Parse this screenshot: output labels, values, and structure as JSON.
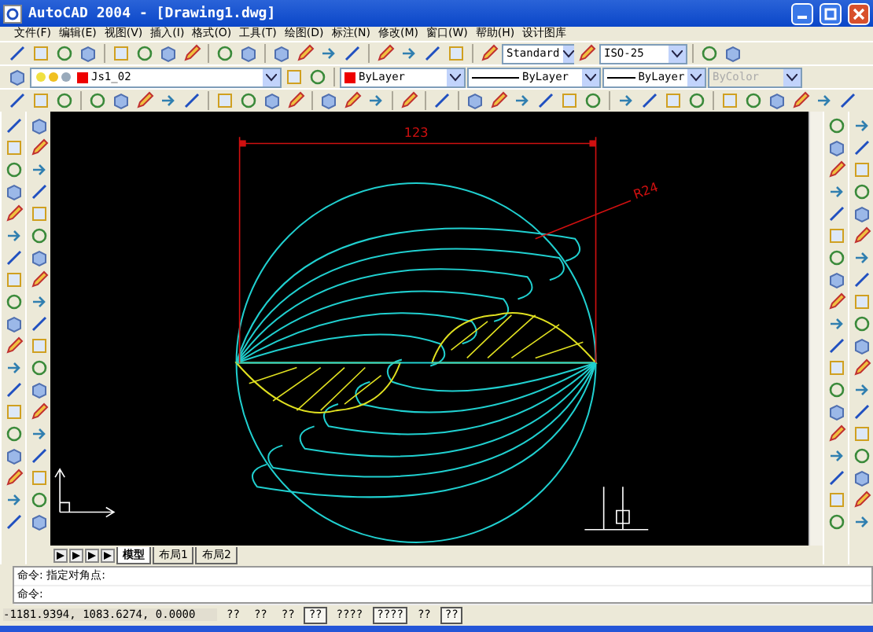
{
  "window": {
    "title": "AutoCAD 2004 - [Drawing1.dwg]"
  },
  "menu": [
    "文件(F)",
    "编辑(E)",
    "视图(V)",
    "插入(I)",
    "格式(O)",
    "工具(T)",
    "绘图(D)",
    "标注(N)",
    "修改(M)",
    "窗口(W)",
    "帮助(H)",
    "设计图库"
  ],
  "toolbar_standard": {
    "text_style": "Standard",
    "dim_style": "ISO-25"
  },
  "toolbar_layers": {
    "layer": "Js1_02",
    "color_setting": "ByLayer",
    "linetype": "ByLayer",
    "lineweight": "ByLayer",
    "plot_style": {
      "value": "ByColor",
      "disabled": true
    }
  },
  "drawing": {
    "dimension": "123",
    "leader_label": "R24"
  },
  "tabs": [
    {
      "label": "模型",
      "selected": true
    },
    {
      "label": "布局1",
      "selected": false
    },
    {
      "label": "布局2",
      "selected": false
    }
  ],
  "command_lines": [
    "命令: 指定对角点:",
    "命令:"
  ],
  "status_bar": {
    "coordinates": "-1181.9394, 1083.6274, 0.0000",
    "toggles": [
      {
        "label": "??",
        "on": false
      },
      {
        "label": "??",
        "on": false
      },
      {
        "label": "??",
        "on": false
      },
      {
        "label": "??",
        "on": true
      },
      {
        "label": "????",
        "on": false
      },
      {
        "label": "????",
        "on": true
      },
      {
        "label": "??",
        "on": false
      },
      {
        "label": "??",
        "on": true
      }
    ]
  }
}
